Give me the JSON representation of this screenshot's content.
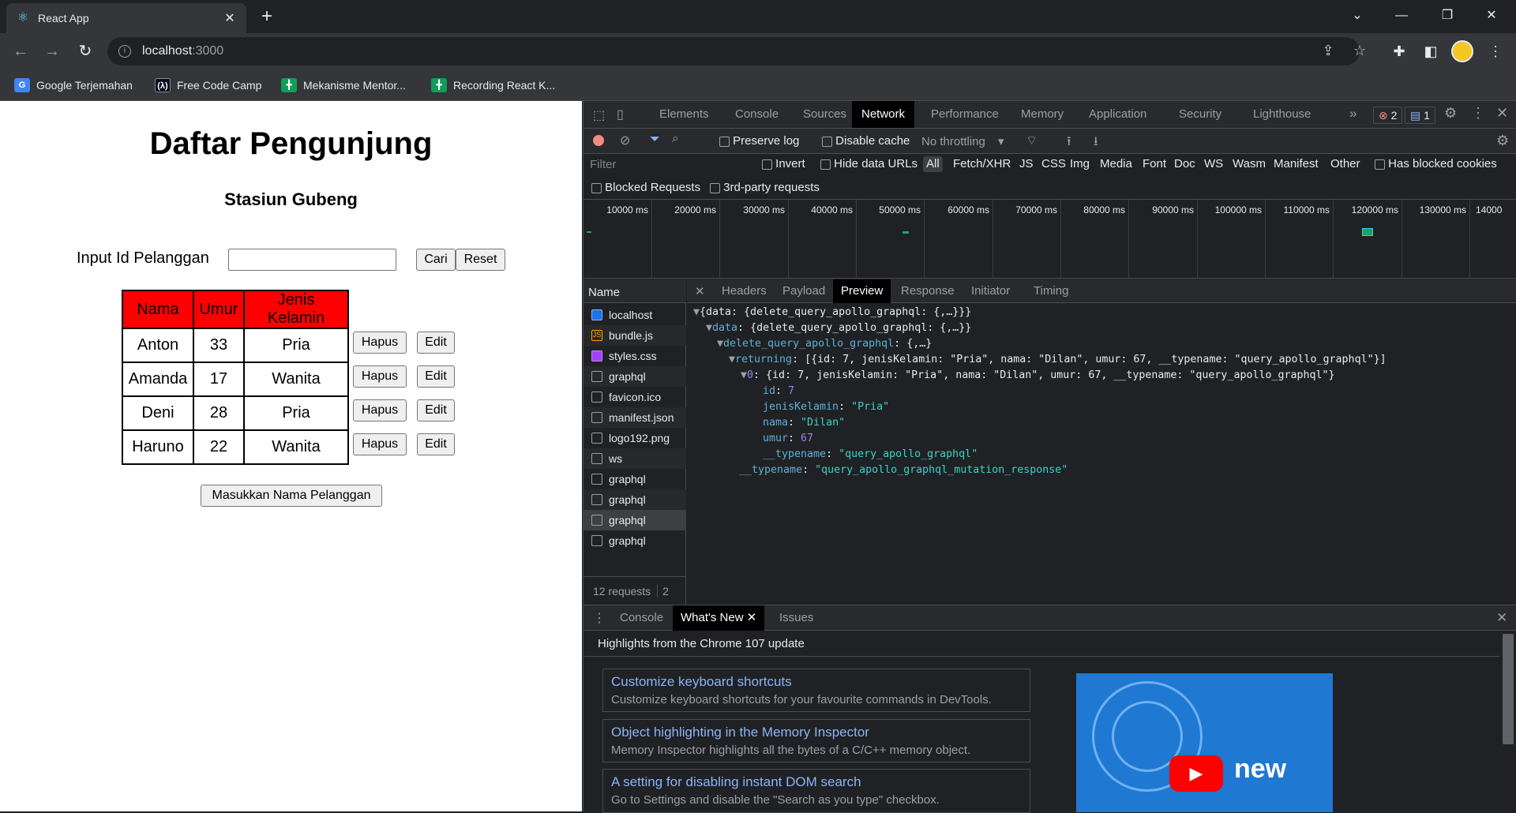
{
  "browser": {
    "tab_title": "React App",
    "url_host": "localhost",
    "url_port": ":3000",
    "bookmarks": [
      {
        "label": "Google Terjemahan",
        "icon": "google-translate-icon"
      },
      {
        "label": "Free Code Camp",
        "icon": "freecodecamp-icon"
      },
      {
        "label": "Mekanisme Mentor...",
        "icon": "sheets-icon"
      },
      {
        "label": "Recording React K...",
        "icon": "sheets-icon"
      }
    ]
  },
  "page": {
    "title": "Daftar Pengunjung",
    "subtitle": "Stasiun Gubeng",
    "input_label": "Input Id Pelanggan",
    "search_button": "Cari",
    "reset_button": "Reset",
    "table": {
      "headers": [
        "Nama",
        "Umur",
        "Jenis Kelamin"
      ],
      "rows": [
        {
          "nama": "Anton",
          "umur": "33",
          "jk": "Pria"
        },
        {
          "nama": "Amanda",
          "umur": "17",
          "jk": "Wanita"
        },
        {
          "nama": "Deni",
          "umur": "28",
          "jk": "Pria"
        },
        {
          "nama": "Haruno",
          "umur": "22",
          "jk": "Wanita"
        }
      ],
      "delete_label": "Hapus",
      "edit_label": "Edit"
    },
    "add_button": "Masukkan Nama Pelanggan",
    "header_color": "#ff0000"
  },
  "devtools": {
    "tabs": [
      "Elements",
      "Console",
      "Sources",
      "Network",
      "Performance",
      "Memory",
      "Application",
      "Security",
      "Lighthouse"
    ],
    "active_tab": "Network",
    "error_count": "2",
    "message_count": "1",
    "toolbar": {
      "preserve_log": "Preserve log",
      "disable_cache": "Disable cache",
      "throttling": "No throttling"
    },
    "filter": {
      "placeholder": "Filter",
      "invert": "Invert",
      "hide_data_urls": "Hide data URLs",
      "types": [
        "All",
        "Fetch/XHR",
        "JS",
        "CSS",
        "Img",
        "Media",
        "Font",
        "Doc",
        "WS",
        "Wasm",
        "Manifest",
        "Other"
      ],
      "has_blocked_cookies": "Has blocked cookies",
      "blocked_requests": "Blocked Requests",
      "third_party": "3rd-party requests"
    },
    "timeline_ticks": [
      "10000 ms",
      "20000 ms",
      "30000 ms",
      "40000 ms",
      "50000 ms",
      "60000 ms",
      "70000 ms",
      "80000 ms",
      "90000 ms",
      "100000 ms",
      "110000 ms",
      "120000 ms",
      "130000 ms",
      "14000"
    ],
    "name_header": "Name",
    "requests": [
      "localhost",
      "bundle.js",
      "styles.css",
      "graphql",
      "favicon.ico",
      "manifest.json",
      "logo192.png",
      "ws",
      "graphql",
      "graphql",
      "graphql",
      "graphql"
    ],
    "selected_request_index": 10,
    "requests_summary": "12 requests",
    "requests_summary_extra": "2",
    "detail_tabs": [
      "Headers",
      "Payload",
      "Preview",
      "Response",
      "Initiator",
      "Timing"
    ],
    "active_detail_tab": "Preview",
    "preview": {
      "line1": "{data: {delete_query_apollo_graphql: {,…}}}",
      "line2_key": "data",
      "line2_val": "{delete_query_apollo_graphql: {,…}}",
      "line3_key": "delete_query_apollo_graphql",
      "line3_val": "{,…}",
      "line4_key": "returning",
      "line4_val": "[{id: 7, jenisKelamin: \"Pria\", nama: \"Dilan\", umur: 67, __typename: \"query_apollo_graphql\"}]",
      "line5_key": "0",
      "line5_val": "{id: 7, jenisKelamin: \"Pria\", nama: \"Dilan\", umur: 67, __typename: \"query_apollo_graphql\"}",
      "id_key": "id",
      "id_val": "7",
      "jk_key": "jenisKelamin",
      "jk_val": "\"Pria\"",
      "nama_key": "nama",
      "nama_val": "\"Dilan\"",
      "umur_key": "umur",
      "umur_val": "67",
      "tn_key": "__typename",
      "tn_val": "\"query_apollo_graphql\"",
      "tn2_key": "__typename",
      "tn2_val": "\"query_apollo_graphql_mutation_response\""
    },
    "drawer": {
      "tabs": [
        "Console",
        "What's New",
        "Issues"
      ],
      "active_tab": "What's New",
      "heading": "Highlights from the Chrome 107 update",
      "cards": [
        {
          "title": "Customize keyboard shortcuts",
          "desc": "Customize keyboard shortcuts for your favourite commands in DevTools."
        },
        {
          "title": "Object highlighting in the Memory Inspector",
          "desc": "Memory Inspector highlights all the bytes of a C/C++ memory object."
        },
        {
          "title": "A setting for disabling instant DOM search",
          "desc": "Go to Settings and disable the \"Search as you type\" checkbox."
        }
      ],
      "video_text": "new"
    }
  }
}
